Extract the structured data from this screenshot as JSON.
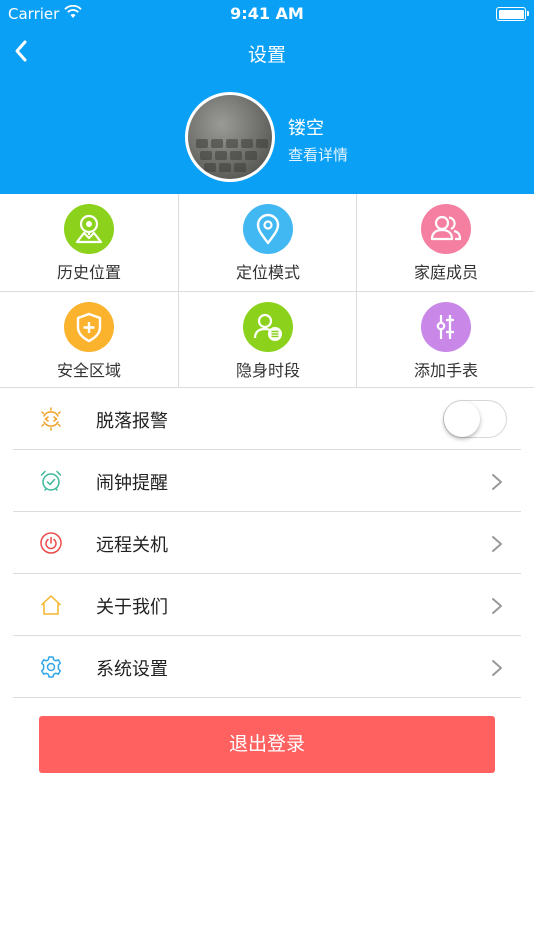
{
  "status_bar": {
    "carrier": "Carrier",
    "time": "9:41 AM"
  },
  "header": {
    "title": "设置",
    "user_name": "镂空",
    "view_details": "查看详情"
  },
  "grid": [
    {
      "label": "历史位置",
      "icon": "map-pin-mountain-icon",
      "color": "#8cd21c"
    },
    {
      "label": "定位模式",
      "icon": "location-pin-icon",
      "color": "#42b8f2"
    },
    {
      "label": "家庭成员",
      "icon": "family-members-icon",
      "color": "#f47fa1"
    },
    {
      "label": "安全区域",
      "icon": "shield-plus-icon",
      "color": "#fbb22c"
    },
    {
      "label": "隐身时段",
      "icon": "user-list-icon",
      "color": "#8cd21c"
    },
    {
      "label": "添加手表",
      "icon": "sliders-plus-icon",
      "color": "#c988e8"
    }
  ],
  "list": {
    "fall_alarm": {
      "label": "脱落报警",
      "icon": "sensor-icon",
      "toggle_on": false
    },
    "alarm_reminder": {
      "label": "闹钟提醒",
      "icon": "alarm-clock-icon"
    },
    "remote_shutdown": {
      "label": "远程关机",
      "icon": "power-icon"
    },
    "about_us": {
      "label": "关于我们",
      "icon": "home-icon"
    },
    "system_settings": {
      "label": "系统设置",
      "icon": "gear-icon"
    }
  },
  "logout": {
    "label": "退出登录",
    "color": "#ff6161"
  },
  "colors": {
    "primary": "#0aa0f5"
  }
}
